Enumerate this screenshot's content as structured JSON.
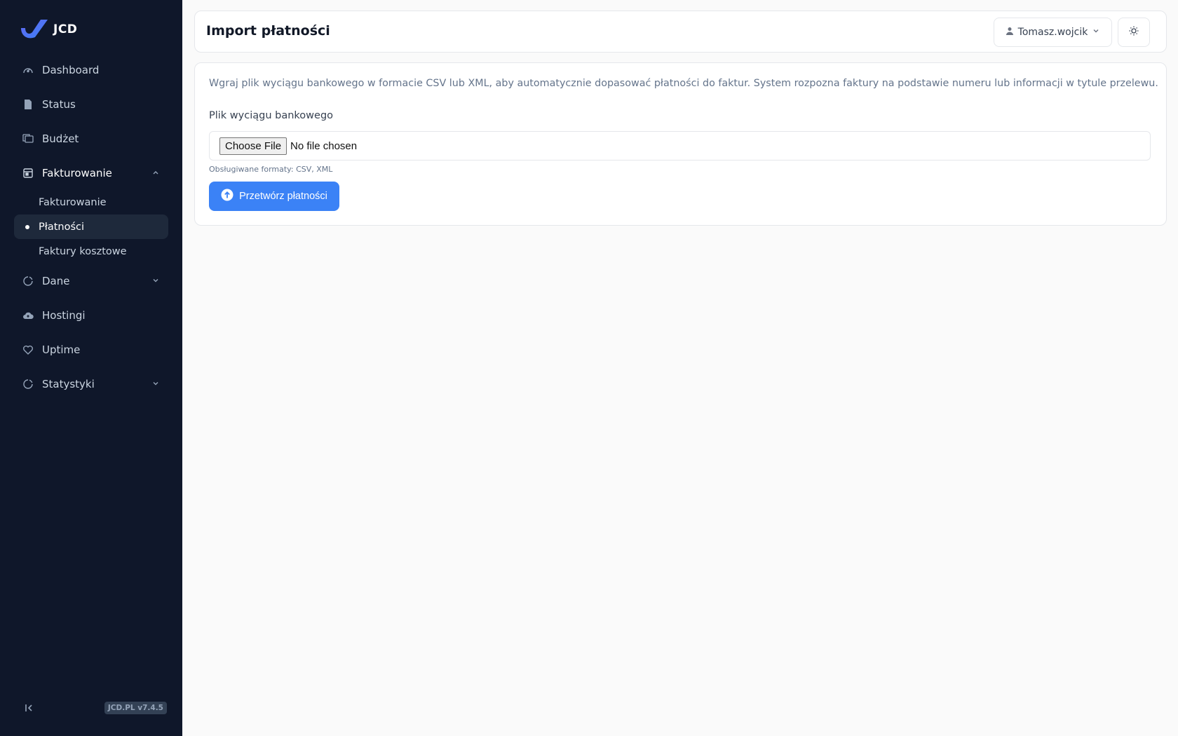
{
  "app": {
    "logo_text": "JCD",
    "version": "JCD.PL v7.4.5"
  },
  "sidebar": {
    "items": [
      {
        "label": "Dashboard",
        "icon": "dashboard-gauge-icon"
      },
      {
        "label": "Status",
        "icon": "document-icon"
      },
      {
        "label": "Budżet",
        "icon": "folders-icon"
      },
      {
        "label": "Fakturowanie",
        "icon": "billing-icon",
        "expanded": true,
        "children": [
          {
            "label": "Fakturowanie",
            "active": false
          },
          {
            "label": "Płatności",
            "active": true
          },
          {
            "label": "Faktury kosztowe",
            "active": false
          }
        ]
      },
      {
        "label": "Dane",
        "icon": "chart-pie-icon",
        "expanded": false
      },
      {
        "label": "Hostingi",
        "icon": "cloud-icon"
      },
      {
        "label": "Uptime",
        "icon": "heart-icon"
      },
      {
        "label": "Statystyki",
        "icon": "chart-pie-icon",
        "expanded": false
      }
    ]
  },
  "header": {
    "title": "Import płatności",
    "user": "Tomasz.wojcik"
  },
  "main": {
    "description": "Wgraj plik wyciągu bankowego w formacie CSV lub XML, aby automatycznie dopasować płatności do faktur. System rozpozna faktury na podstawie numeru lub informacji w tytule przelewu.",
    "file_label": "Plik wyciągu bankowego",
    "choose_file": "Choose File",
    "file_status": "No file chosen",
    "hint": "Obsługiwane formaty: CSV, XML",
    "submit": "Przetwórz płatności"
  },
  "colors": {
    "sidebar_bg": "#0f172a",
    "accent": "#3b82f6",
    "page_bg": "#fafafa"
  }
}
